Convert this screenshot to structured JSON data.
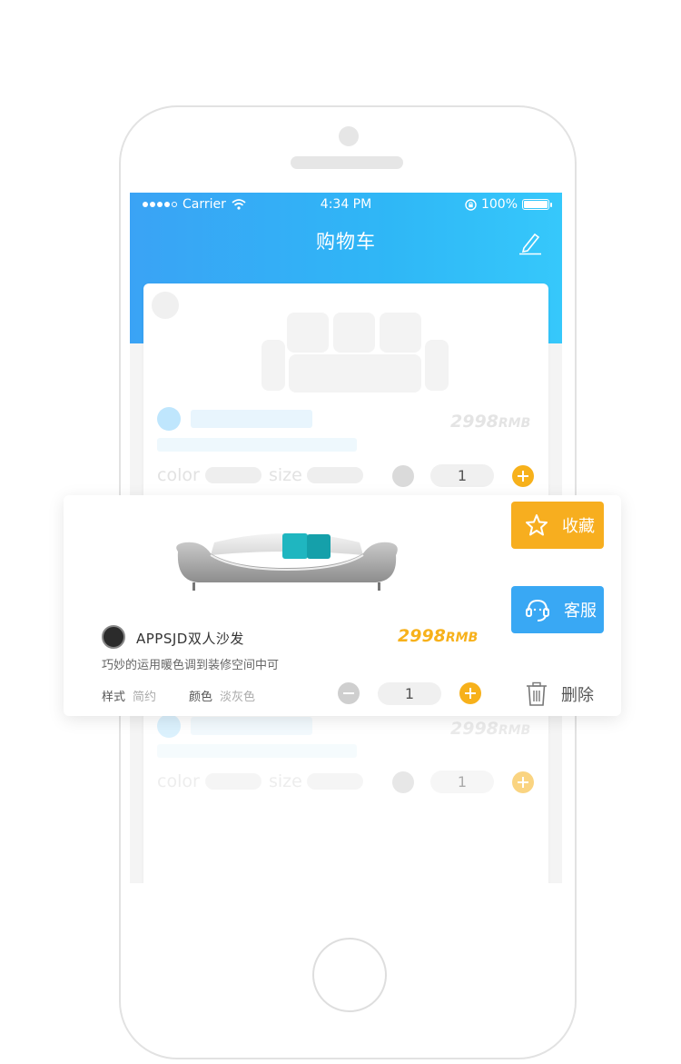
{
  "status_bar": {
    "carrier": "Carrier",
    "time": "4:34 PM",
    "battery": "100%"
  },
  "nav": {
    "title": "购物车",
    "edit_icon": "edit-pencil-icon"
  },
  "ghost_item": {
    "price_num": "2998",
    "price_unit": "RMB",
    "color_label": "color",
    "size_label": "size",
    "quantity": "1"
  },
  "ghost_item_lower": {
    "price_num": "2998",
    "price_unit": "RMB",
    "color_label": "color",
    "size_label": "size",
    "quantity": "1"
  },
  "product": {
    "name": "APPSJD双人沙发",
    "description": "巧妙的运用暖色调到装修空间中可",
    "price_num": "2998",
    "price_unit": "RMB",
    "style_label": "样式",
    "style_value": "简约",
    "color_label": "颜色",
    "color_value": "淡灰色",
    "quantity": "1"
  },
  "actions": {
    "favorite": "收藏",
    "service": "客服",
    "delete": "删除"
  },
  "colors": {
    "accent_blue": "#39a8f4",
    "accent_orange": "#f7b11b"
  }
}
